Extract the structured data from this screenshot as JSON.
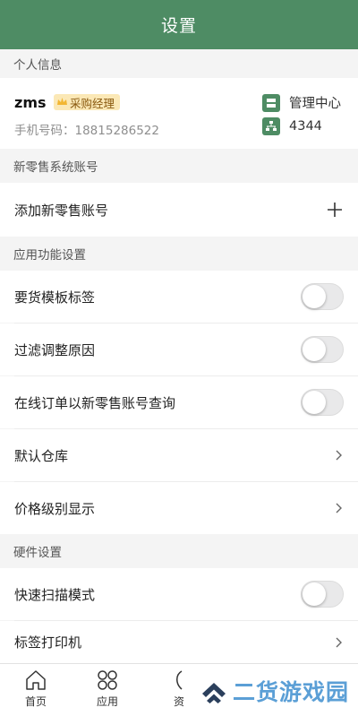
{
  "header": {
    "title": "设置"
  },
  "personal": {
    "section_title": "个人信息",
    "user_name": "zms",
    "role": "采购经理",
    "phone": "手机号码：18815286522",
    "management_center": "管理中心",
    "store_code": "4344"
  },
  "retail": {
    "section_title": "新零售系统账号",
    "add_label": "添加新零售账号"
  },
  "app_settings": {
    "section_title": "应用功能设置",
    "items": [
      {
        "label": "要货模板标签",
        "enabled": false
      },
      {
        "label": "过滤调整原因",
        "enabled": false
      },
      {
        "label": "在线订单以新零售账号查询",
        "enabled": false
      },
      {
        "label": "默认仓库"
      },
      {
        "label": "价格级别显示"
      }
    ]
  },
  "hardware": {
    "section_title": "硬件设置",
    "items": [
      {
        "label": "快速扫描模式",
        "enabled": false
      },
      {
        "label": "标签打印机"
      }
    ]
  },
  "tabbar": {
    "tabs": [
      {
        "label": "首页",
        "icon": "home-icon"
      },
      {
        "label": "应用",
        "icon": "apps-icon"
      },
      {
        "label": "资",
        "icon": "resource-icon"
      }
    ]
  },
  "watermark": {
    "text": "二货游戏园"
  }
}
